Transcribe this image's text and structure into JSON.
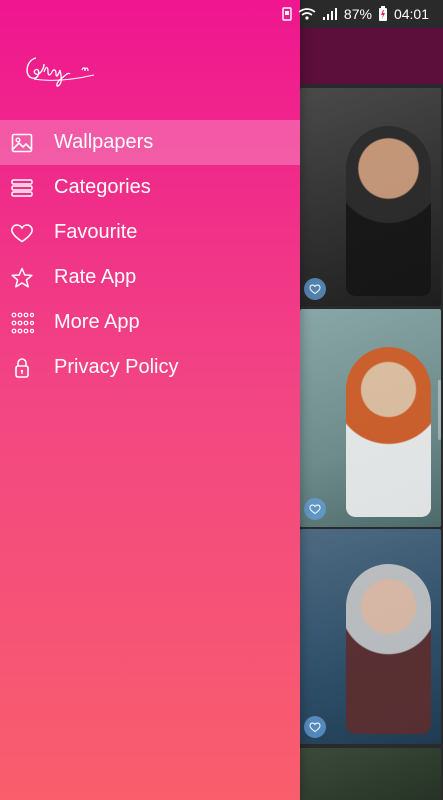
{
  "status_bar": {
    "battery_percent": "87%",
    "time": "04:01"
  },
  "drawer": {
    "logo_icon": "signature-logo",
    "items": [
      {
        "label": "Wallpapers",
        "icon": "image-icon",
        "active": true
      },
      {
        "label": "Categories",
        "icon": "list-icon",
        "active": false
      },
      {
        "label": "Favourite",
        "icon": "heart-icon",
        "active": false
      },
      {
        "label": "Rate App",
        "icon": "star-icon",
        "active": false
      },
      {
        "label": "More App",
        "icon": "grid-icon",
        "active": false
      },
      {
        "label": "Privacy Policy",
        "icon": "lock-icon",
        "active": false
      }
    ]
  },
  "colors": {
    "drawer_top": "#ef168f",
    "drawer_bottom": "#f95e6c",
    "active_highlight": "rgba(255,255,255,0.24)",
    "toolbar": "#5b0f3a"
  }
}
